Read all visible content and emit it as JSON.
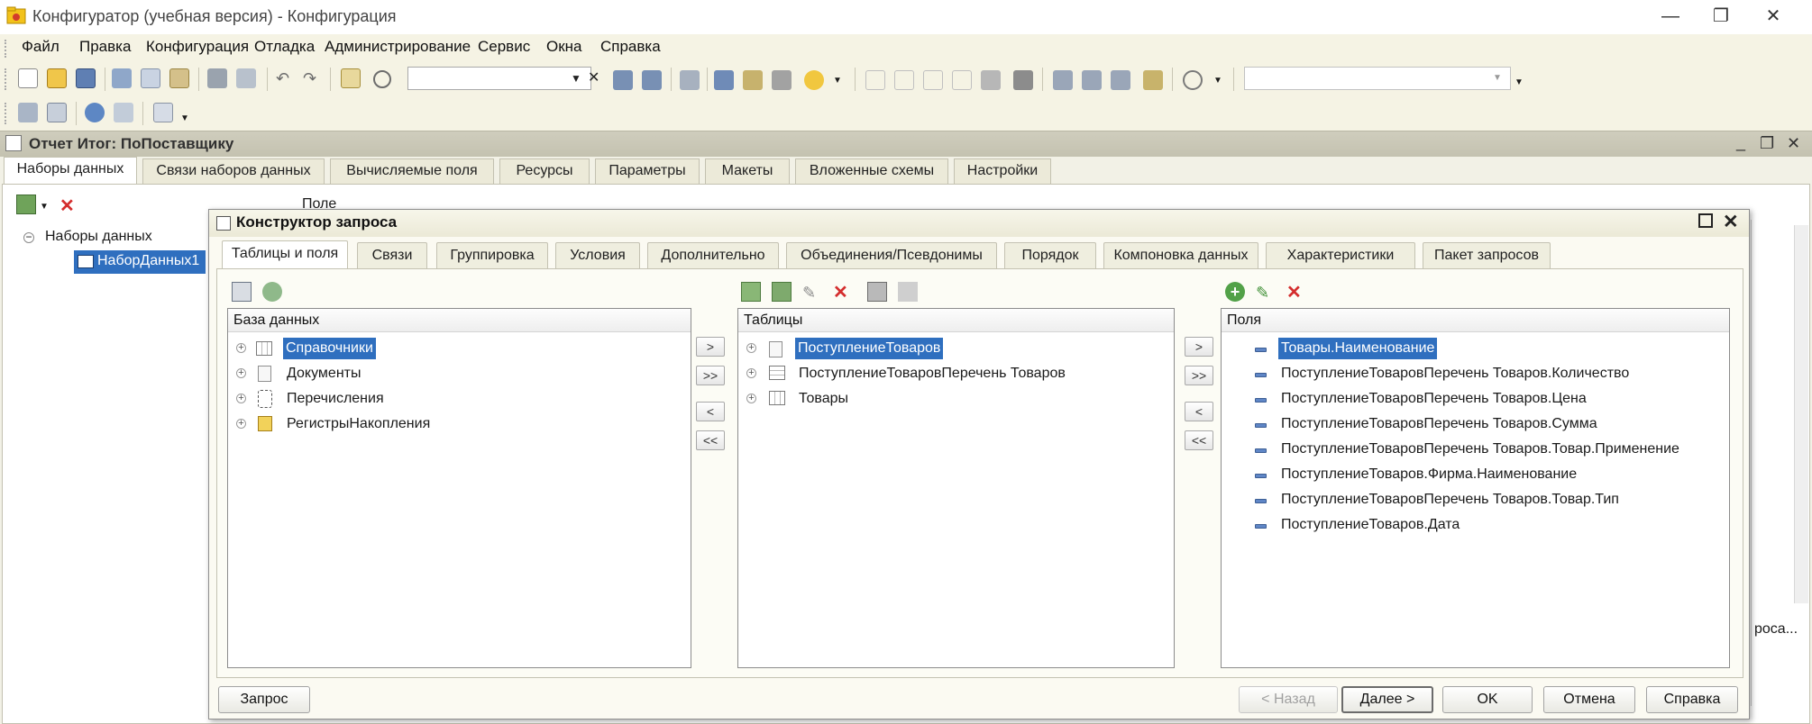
{
  "window": {
    "title": "Конфигуратор (учебная версия) - Конфигурация",
    "min": "—",
    "restore": "❐",
    "close": "✕"
  },
  "menu": [
    "Файл",
    "Правка",
    "Конфигурация",
    "Отладка",
    "Администрирование",
    "Сервис",
    "Окна",
    "Справка"
  ],
  "report": {
    "title": "Отчет Итог: ПоПоставщику",
    "controls": {
      "min": "_",
      "restore": "❐",
      "close": "✕"
    },
    "tabs": [
      "Наборы данных",
      "Связи наборов данных",
      "Вычисляемые поля",
      "Ресурсы",
      "Параметры",
      "Макеты",
      "Вложенные схемы",
      "Настройки"
    ],
    "tree": {
      "root": "Наборы данных",
      "child": "НаборДанных1"
    },
    "hidden_label": "Поле",
    "right_text": "роса..."
  },
  "dialog": {
    "title": "Конструктор запроса",
    "tabs": [
      "Таблицы и поля",
      "Связи",
      "Группировка",
      "Условия",
      "Дополнительно",
      "Объединения/Псевдонимы",
      "Порядок",
      "Компоновка данных",
      "Характеристики",
      "Пакет запросов"
    ],
    "db_panel": {
      "header": "База данных",
      "items": [
        "Справочники",
        "Документы",
        "Перечисления",
        "РегистрыНакопления"
      ]
    },
    "tables_panel": {
      "header": "Таблицы",
      "items": [
        "ПоступлениеТоваров",
        "ПоступлениеТоваровПеречень Товаров",
        "Товары"
      ]
    },
    "fields_panel": {
      "header": "Поля",
      "items": [
        "Товары.Наименование",
        "ПоступлениеТоваровПеречень Товаров.Количество",
        "ПоступлениеТоваровПеречень Товаров.Цена",
        "ПоступлениеТоваровПеречень Товаров.Сумма",
        "ПоступлениеТоваровПеречень Товаров.Товар.Применение",
        "ПоступлениеТоваров.Фирма.Наименование",
        "ПоступлениеТоваровПеречень Товаров.Товар.Тип",
        "ПоступлениеТоваров.Дата"
      ]
    },
    "move": {
      "one": ">",
      "all": ">>",
      "back": "<",
      "back_all": "<<"
    },
    "buttons": {
      "query": "Запрос",
      "back": "< Назад",
      "next": "Далее >",
      "ok": "OK",
      "cancel": "Отмена",
      "help": "Справка"
    }
  },
  "colors": {
    "accent": "#2f6fbf",
    "window_bg": "#f5f3e4"
  }
}
